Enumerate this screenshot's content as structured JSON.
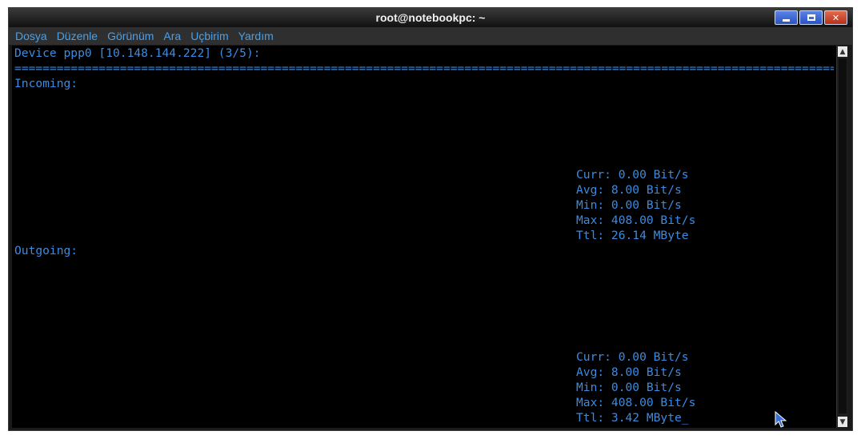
{
  "window": {
    "title": "root@notebookpc: ~"
  },
  "menu": {
    "items": [
      "Dosya",
      "Düzenle",
      "Görünüm",
      "Ara",
      "Uçbirim",
      "Yardım"
    ]
  },
  "terminal": {
    "device_line": "Device ppp0 [10.148.144.222] (3/5):",
    "separator": "================================================================================================================================",
    "incoming": {
      "label": "Incoming:",
      "curr": "Curr: 0.00 Bit/s",
      "avg": "Avg: 8.00 Bit/s",
      "min": "Min: 0.00 Bit/s",
      "max": "Max: 408.00 Bit/s",
      "ttl": "Ttl: 26.14 MByte"
    },
    "outgoing": {
      "label": "Outgoing:",
      "curr": "Curr: 0.00 Bit/s",
      "avg": "Avg: 8.00 Bit/s",
      "min": "Min: 0.00 Bit/s",
      "max": "Max: 408.00 Bit/s",
      "ttl": "Ttl: 3.42 MByte_"
    }
  },
  "colors": {
    "terminal_text": "#3d8be0",
    "terminal_bg": "#000000",
    "menu_text": "#4aa0e8"
  },
  "icons": {
    "minimize": "minimize-icon",
    "maximize": "maximize-icon",
    "close": "close-icon",
    "pointer": "mouse-pointer-icon"
  }
}
